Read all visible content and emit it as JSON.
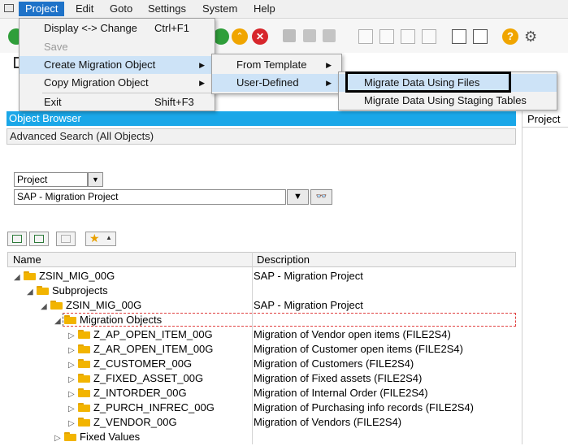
{
  "menubar": {
    "items": [
      {
        "label": "Project"
      },
      {
        "label": "Edit"
      },
      {
        "label": "Goto"
      },
      {
        "label": "Settings"
      },
      {
        "label": "System"
      },
      {
        "label": "Help"
      }
    ]
  },
  "project_menu": {
    "display_change": {
      "label": "Display <-> Change",
      "shortcut": "Ctrl+F1"
    },
    "save": {
      "label": "Save"
    },
    "create_migration_object": {
      "label": "Create Migration Object"
    },
    "copy_migration_object": {
      "label": "Copy Migration Object"
    },
    "exit": {
      "label": "Exit",
      "shortcut": "Shift+F3"
    }
  },
  "create_submenu": {
    "from_template": {
      "label": "From Template"
    },
    "user_defined": {
      "label": "User-Defined"
    }
  },
  "userdef_submenu": {
    "migrate_files": {
      "label": "Migrate Data Using Files"
    },
    "migrate_staging": {
      "label": "Migrate Data Using Staging Tables"
    }
  },
  "object_browser": {
    "title": "Object Browser",
    "advanced_search": "Advanced Search (All Objects)",
    "search_type": "Project",
    "project_value": "SAP - Migration Project"
  },
  "right_panel": {
    "header": "Project"
  },
  "table": {
    "col_name": "Name",
    "col_desc": "Description",
    "rows": [
      {
        "name": "ZSIN_MIG_00G",
        "desc": "SAP - Migration Project"
      },
      {
        "name": "Subprojects",
        "desc": ""
      },
      {
        "name": "ZSIN_MIG_00G",
        "desc": "SAP - Migration Project"
      },
      {
        "name": "Migration Objects",
        "desc": ""
      },
      {
        "name": "Z_AP_OPEN_ITEM_00G",
        "desc": "Migration of Vendor open items (FILE2S4)"
      },
      {
        "name": "Z_AR_OPEN_ITEM_00G",
        "desc": "Migration of Customer open items (FILE2S4)"
      },
      {
        "name": "Z_CUSTOMER_00G",
        "desc": "Migration of Customers (FILE2S4)"
      },
      {
        "name": "Z_FIXED_ASSET_00G",
        "desc": "Migration of Fixed assets (FILE2S4)"
      },
      {
        "name": "Z_INTORDER_00G",
        "desc": "Migration of Internal Order (FILE2S4)"
      },
      {
        "name": "Z_PURCH_INFREC_00G",
        "desc": "Migration of Purchasing info records (FILE2S4)"
      },
      {
        "name": "Z_VENDOR_00G",
        "desc": "Migration of Vendors (FILE2S4)"
      },
      {
        "name": "Fixed Values",
        "desc": ""
      }
    ]
  },
  "colors": {
    "accent": "#1e72c8",
    "header_blue": "#1aa7e8",
    "folder": "#f2b400",
    "highlight_frame": "#000000"
  }
}
